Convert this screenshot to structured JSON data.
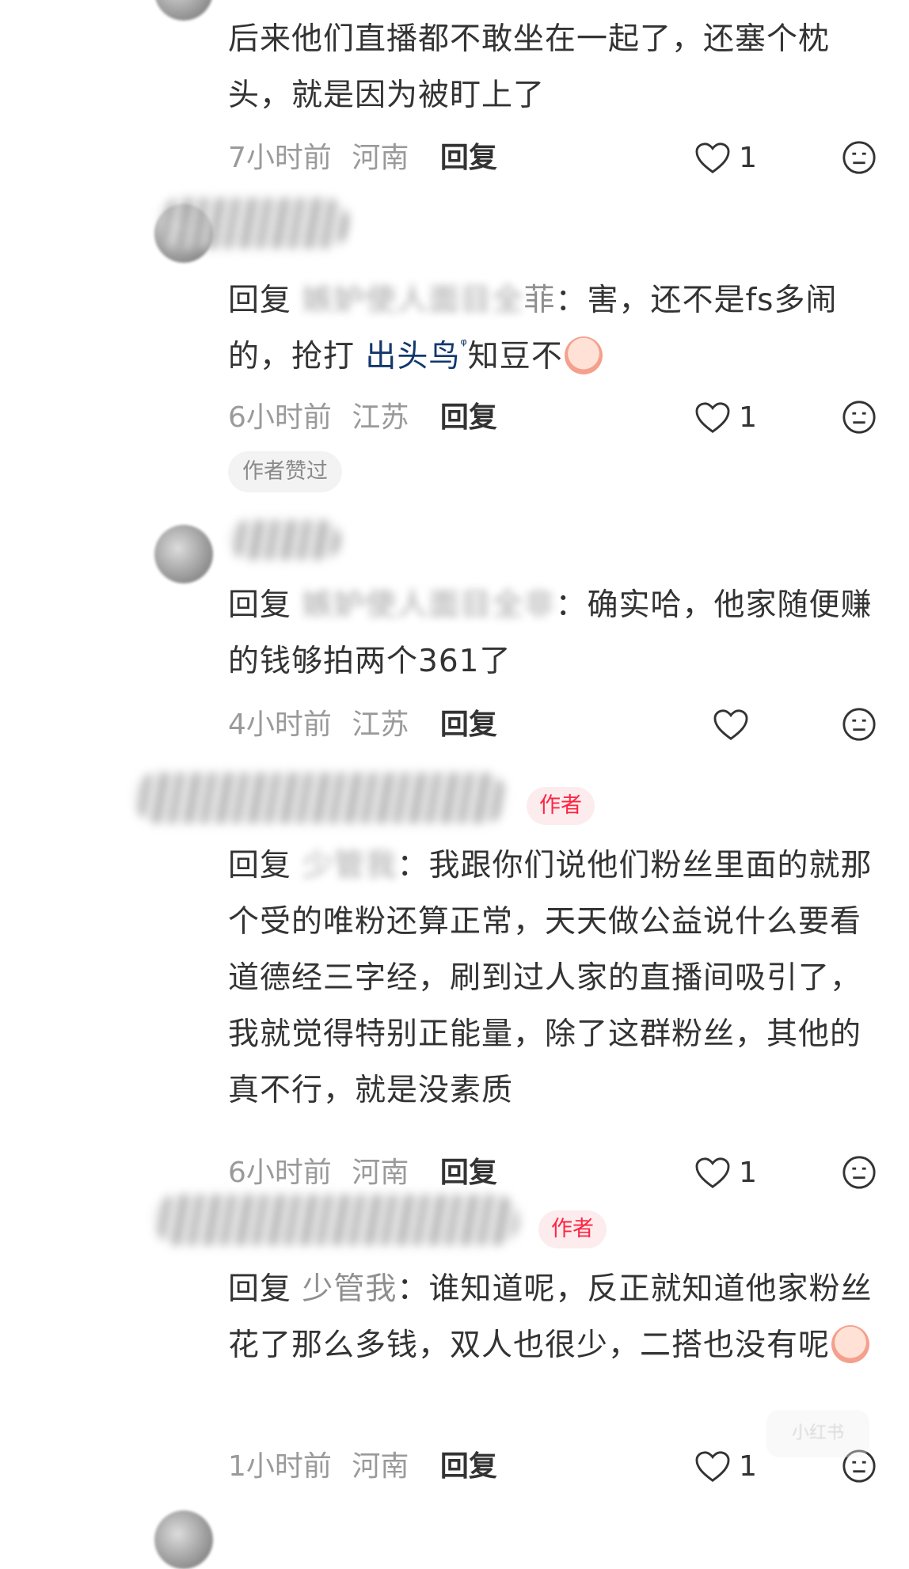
{
  "comments": [
    {
      "text": "后来他们直播都不敢坐在一起了，还塞个枕头，就是因为被盯上了",
      "time": "7小时前",
      "location": "河南",
      "reply_label": "回复",
      "likes": "1"
    },
    {
      "reply_prefix": "回复",
      "reply_target_tail": "菲",
      "text_a": "：害，还不是fs多闹的，抢打",
      "topic": "出头鸟",
      "text_b": "知豆不",
      "time": "6小时前",
      "location": "江苏",
      "reply_label": "回复",
      "likes": "1",
      "badge": "作者赞过"
    },
    {
      "reply_prefix": "回复",
      "reply_target": "嫉妒使人面目全非",
      "text": "：确实哈，他家随便赚的钱够拍两个361了",
      "time": "4小时前",
      "location": "江苏",
      "reply_label": "回复",
      "likes": ""
    },
    {
      "author_tag": "作者",
      "reply_prefix": "回复",
      "reply_target": "少管我",
      "text": "：我跟你们说他们粉丝里面的就那个受的唯粉还算正常，天天做公益说什么要看道德经三字经，刷到过人家的直播间吸引了，我就觉得特别正能量，除了这群粉丝，其他的真不行，就是没素质",
      "time": "6小时前",
      "location": "河南",
      "reply_label": "回复",
      "likes": "1"
    },
    {
      "author_tag": "作者",
      "reply_prefix": "回复",
      "reply_target": "少管我",
      "text": "：谁知道呢，反正就知道他家粉丝花了那么多钱，双人也很少，二搭也没有呢",
      "time": "1小时前",
      "location": "河南",
      "reply_label": "回复",
      "likes": "1"
    }
  ],
  "watermark": "小红书",
  "colors": {
    "text": "#333333",
    "meta": "#9a9a9a",
    "accent": "#ff2442",
    "link": "#13386c"
  }
}
